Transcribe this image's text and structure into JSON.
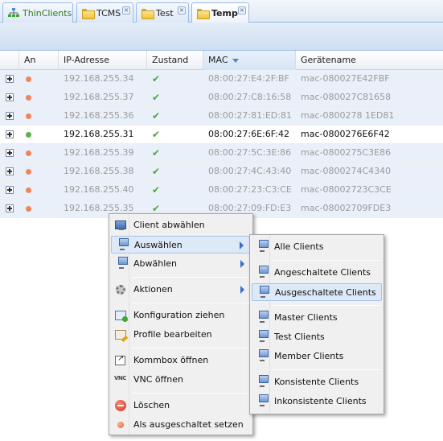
{
  "tabs": [
    {
      "label": "ThinClients",
      "icon": "network-tree-icon",
      "closable": false,
      "active": false
    },
    {
      "label": "TCMS",
      "icon": "folder-icon",
      "closable": true,
      "active": false
    },
    {
      "label": "Test",
      "icon": "folder-icon",
      "closable": true,
      "active": false
    },
    {
      "label": "Temp",
      "icon": "folder-icon",
      "closable": true,
      "active": true
    }
  ],
  "close_glyph": "×",
  "grid": {
    "columns": [
      "An",
      "IP-Adresse",
      "Zustand",
      "MAC",
      "Gerätename"
    ],
    "sorted_column": "MAC",
    "check_glyph": "✔",
    "rows": [
      {
        "online": false,
        "ip": "192.168.255.34",
        "mac": "08:00:27:E4:2F:BF",
        "name": "mac-080027E42FBF"
      },
      {
        "online": false,
        "ip": "192.168.255.37",
        "mac": "08:00:27:C8:16:58",
        "name": "mac-080027C81658"
      },
      {
        "online": false,
        "ip": "192.168.255.36",
        "mac": "08:00:27:81:ED:81",
        "name": "mac-0800278 1ED81"
      },
      {
        "online": true,
        "ip": "192.168.255.31",
        "mac": "08:00:27:6E:6F:42",
        "name": "mac-0800276E6F42"
      },
      {
        "online": false,
        "ip": "192.168.255.39",
        "mac": "08:00:27:5C:3E:86",
        "name": "mac-0800275C3E86"
      },
      {
        "online": false,
        "ip": "192.168.255.38",
        "mac": "08:00:27:4C:43:40",
        "name": "mac-0800274C4340"
      },
      {
        "online": false,
        "ip": "192.168.255.40",
        "mac": "08:00:27:23:C3:CE",
        "name": "mac-08002723C3CE"
      },
      {
        "online": false,
        "ip": "192.168.255.35",
        "mac": "08:00:27:09:FD:E3",
        "name": "mac-08002709FDE3"
      }
    ]
  },
  "context_menu": {
    "items": [
      {
        "label": "Client abwählen",
        "icon": "monitor-icon"
      },
      {
        "label": "Auswählen",
        "icon": "monitors-icon",
        "submenu": true,
        "hover": true
      },
      {
        "label": "Abwählen",
        "icon": "monitors-icon",
        "submenu": true
      },
      {
        "label": "Aktionen",
        "icon": "gear-icon",
        "submenu": true
      },
      {
        "label": "Konfiguration ziehen",
        "icon": "config-pull-icon"
      },
      {
        "label": "Profile bearbeiten",
        "icon": "profile-edit-icon"
      },
      {
        "label": "Kommbox öffnen",
        "icon": "external-window-icon"
      },
      {
        "label": "VNC öffnen",
        "icon": "vnc-icon",
        "icon_text": "VNC"
      },
      {
        "label": "Löschen",
        "icon": "delete-icon"
      },
      {
        "label": "Als ausgeschaltet setzen",
        "icon": "offline-dot-icon"
      }
    ]
  },
  "submenu": {
    "items": [
      {
        "label": "Alle Clients"
      },
      {
        "label": "Angeschaltete Clients"
      },
      {
        "label": "Ausgeschaltete Clients",
        "hover": true
      },
      {
        "label": "Master Clients"
      },
      {
        "label": "Test Clients"
      },
      {
        "label": "Member Clients"
      },
      {
        "label": "Konsistente Clients"
      },
      {
        "label": "Inkonsistente Clients"
      }
    ]
  },
  "colors": {
    "online_dot": "#5cb14a",
    "offline_dot": "#f0845a",
    "accent": "#99bbe8"
  }
}
